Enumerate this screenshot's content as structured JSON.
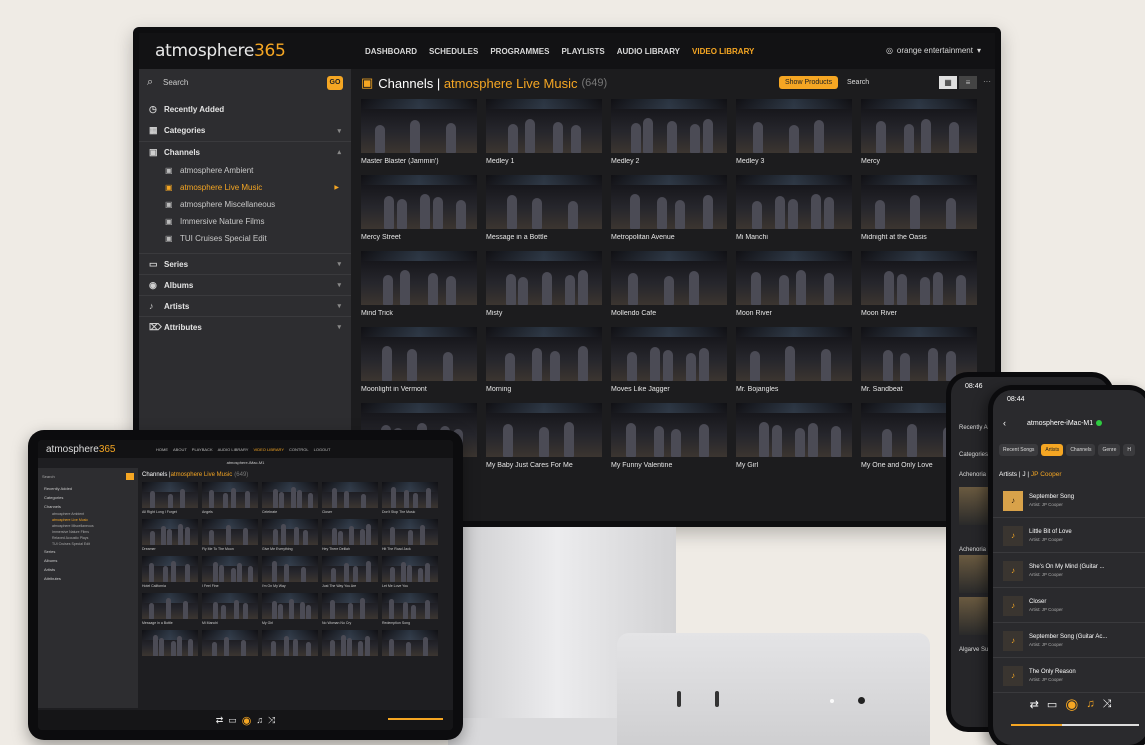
{
  "desktop": {
    "logo_text": "atmosphere",
    "logo_num": "365",
    "nav": [
      "DASHBOARD",
      "SCHEDULES",
      "PROGRAMMES",
      "PLAYLISTS",
      "AUDIO LIBRARY",
      "VIDEO LIBRARY"
    ],
    "nav_active": "VIDEO LIBRARY",
    "account": "orange entertainment",
    "sidebar": {
      "search_label": "Search",
      "go_label": "GO",
      "recently_added": "Recently Added",
      "categories": "Categories",
      "channels": "Channels",
      "channel_items": [
        "atmosphere Ambient",
        "atmosphere Live Music",
        "atmosphere Miscellaneous",
        "Immersive Nature Films",
        "TUI Cruises Special Edit"
      ],
      "active_channel": "atmosphere Live Music",
      "series": "Series",
      "albums": "Albums",
      "artists": "Artists",
      "attributes": "Attributes"
    },
    "main": {
      "title_prefix": "Channels | ",
      "title_accent": "atmosphere Live Music",
      "count": "(649)",
      "show_products": "Show Products",
      "search_label": "Search",
      "tiles": [
        "Master Blaster (Jammin')",
        "Medley 1",
        "Medley 2",
        "Medley 3",
        "Mercy",
        "Mercy Street",
        "Message in a Bottle",
        "Metropolitan Avenue",
        "Mi Manchi",
        "Midnight at the Oasis",
        "Mind Trick",
        "Misty",
        "Mollendo Cafe",
        "Moon River",
        "Moon River",
        "Moonlight in Vermont",
        "Morning",
        "Moves Like Jagger",
        "Mr. Bojangles",
        "Mr. Sandbeat",
        "",
        "My Baby Just Cares For Me",
        "My Funny Valentine",
        "My Girl",
        "My One and Only Love"
      ]
    }
  },
  "tablet": {
    "logo_text": "atmosphere",
    "logo_num": "365",
    "nav": [
      "HOME",
      "ABOUT",
      "PLAYBACK",
      "AUDIO LIBRARY",
      "VIDEO LIBRARY",
      "CONTROL",
      "LOGOUT"
    ],
    "device": "atmosphere-iMac-M1",
    "search_label": "Search",
    "sidebar_items": [
      "Recently Added",
      "Categories",
      "Channels"
    ],
    "channel_items": [
      "atmosphere Ambient",
      "atmosphere Live Music",
      "atmosphere Miscellaneous",
      "Immersive Nature Films",
      "Relaxed Acoustic Plays",
      "TUI Cruises Special Edit"
    ],
    "active_channel": "atmosphere Live Music",
    "sidebar_items2": [
      "Series",
      "Albums",
      "Artists",
      "Attributes"
    ],
    "title_prefix": "Channels | ",
    "title_accent": "atmosphere Live Music",
    "count": "(649)",
    "tiles": [
      "All Right Long I Forget",
      "Angels",
      "Celebrate",
      "Closer",
      "Don't Stop The Music",
      "Dreamer",
      "Fly Me To The Moon",
      "Give Me Everything",
      "Hey There Delilah",
      "Hit The Road Jack",
      "Hotel California",
      "I Feel Fine",
      "I'm On My Way",
      "Just The Way You Are",
      "Let Me Love You",
      "Message in a Bottle",
      "Mi Manchi",
      "My Girl",
      "No Woman No Cry",
      "Redemption Song",
      "",
      "",
      "",
      "",
      ""
    ]
  },
  "phone1": {
    "time": "08:46",
    "labels": [
      "Recently Ad",
      "Categories",
      "Achenoria Sc",
      "Achenoria Sc",
      "Algarve Ma",
      "Algarve Sun"
    ]
  },
  "phone2": {
    "time": "08:44",
    "device": "atmosphere-iMac-M1",
    "tabs": [
      "Recent Songs",
      "Artists",
      "Channels",
      "Genre",
      "H"
    ],
    "active_tab": "Artists",
    "path_prefix": "Artists | J | ",
    "path_accent": "JP Cooper",
    "songs": [
      {
        "title": "September Song",
        "artist": "Artist: JP Cooper"
      },
      {
        "title": "Little Bit of Love",
        "artist": "Artist: JP Cooper"
      },
      {
        "title": "She's On My Mind (Guitar ...",
        "artist": "Artist: JP Cooper"
      },
      {
        "title": "Closer",
        "artist": "Artist: JP Cooper"
      },
      {
        "title": "September Song (Guitar Ac...",
        "artist": "Artist: JP Cooper"
      },
      {
        "title": "The Only Reason",
        "artist": "Artist: JP Cooper"
      }
    ],
    "volume": 0.4
  }
}
